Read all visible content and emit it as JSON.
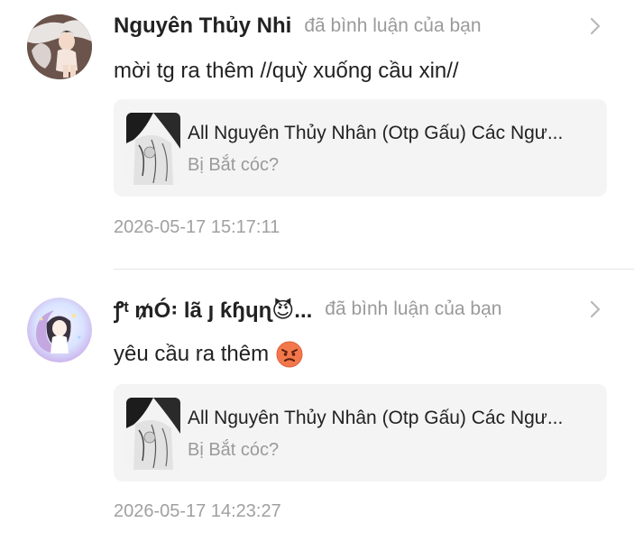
{
  "notifications": [
    {
      "avatar_icon": "user-avatar-icon",
      "username": "Nguyên Thủy Nhi",
      "action": "đã bình luận của bạn",
      "comment": "mời tg ra thêm //quỳ xuống cầu xin//",
      "comment_emoji": null,
      "story": {
        "title": "All Nguyên Thủy Nhân (Otp Gấu) Các Ngư...",
        "chapter": "Bị Bắt cóc?"
      },
      "timestamp": "2026-05-17 15:17:11"
    },
    {
      "avatar_icon": "user-avatar-icon",
      "username": "ꝭᵗ ₥Ó꞉ lã ȷ ƙɧɥɳ😈...",
      "action": "đã bình luận của bạn",
      "comment": "yêu cầu ra thêm",
      "comment_emoji": "angry-face-emoji",
      "story": {
        "title": "All Nguyên Thủy Nhân (Otp Gấu) Các Ngư...",
        "chapter": "Bị Bắt cóc?"
      },
      "timestamp": "2026-05-17 14:23:27"
    }
  ],
  "colors": {
    "text_primary": "#222222",
    "text_secondary": "#9a9a9a",
    "card_background": "#f4f4f4",
    "divider": "#e6e6e6",
    "emoji_face": "#f2784b"
  }
}
